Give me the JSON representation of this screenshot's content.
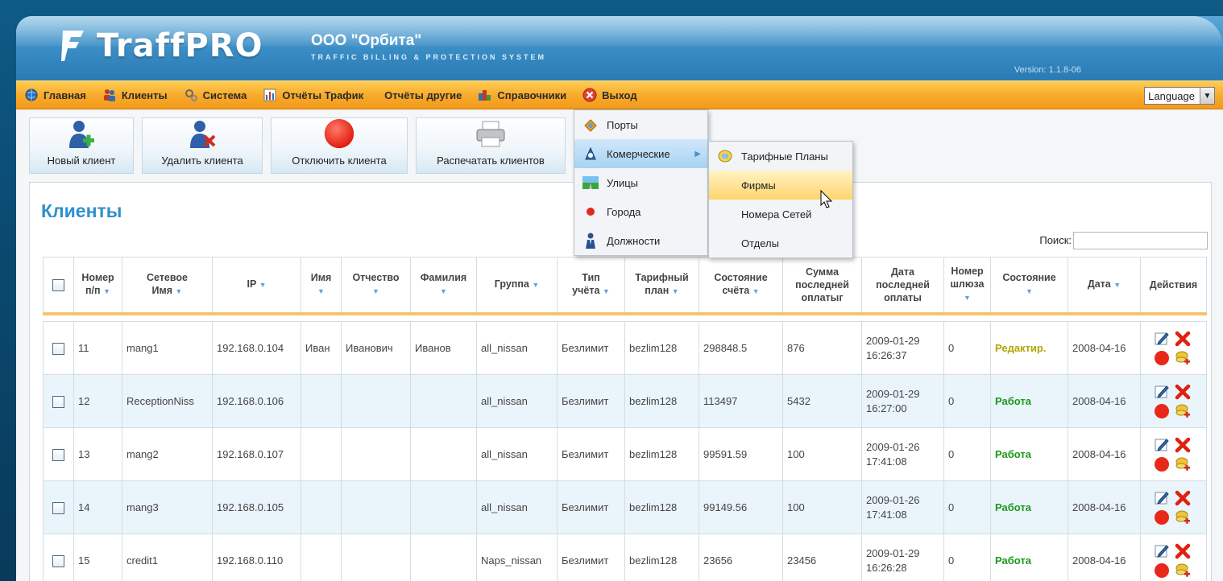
{
  "header": {
    "logo_text": "TraffPRO",
    "company": "ООО \"Орбита\"",
    "tagline": "TRAFFIC BILLING & PROTECTION SYSTEM",
    "version": "Version: 1.1.8-06"
  },
  "menu": {
    "items": [
      {
        "label": "Главная",
        "icon": "globe-icon"
      },
      {
        "label": "Клиенты",
        "icon": "users-icon"
      },
      {
        "label": "Система",
        "icon": "gears-icon"
      },
      {
        "label": "Отчёты Трафик",
        "icon": "bar-chart-icon"
      },
      {
        "label": "Отчёты другие",
        "icon": ""
      },
      {
        "label": "Справочники",
        "icon": "directory-icon"
      },
      {
        "label": "Выход",
        "icon": "exit-icon"
      }
    ],
    "language": "Language"
  },
  "toolbar": {
    "new_client": "Новый клиент",
    "delete_client": "Удалить клиента",
    "disable_client": "Отключить клиента",
    "print_clients": "Распечатать клиентов"
  },
  "dropdown": {
    "items": [
      "Порты",
      "Комерческие",
      "Улицы",
      "Города",
      "Должности"
    ],
    "submenu": [
      "Тарифные Планы",
      "Фирмы",
      "Номера Сетей",
      "Отделы"
    ]
  },
  "page": {
    "title": "Клиенты",
    "search_label": "Поиск:"
  },
  "table": {
    "headers": {
      "num": [
        "Номер",
        "п/п"
      ],
      "netname": [
        "Сетевое",
        "Имя"
      ],
      "ip": "IP",
      "name": "Имя",
      "patronymic": "Отчество",
      "surname": "Фамилия",
      "group": "Группа",
      "acct_type": [
        "Тип",
        "учёта"
      ],
      "tariff": [
        "Тарифный",
        "план"
      ],
      "balance": [
        "Состояние",
        "счёта"
      ],
      "last_payment": [
        "Сумма",
        "последней",
        "оплатыг"
      ],
      "last_payment_date": [
        "Дата",
        "последней",
        "оплаты"
      ],
      "gateway": [
        "Номер",
        "шлюза"
      ],
      "state": "Состояние",
      "date": "Дата",
      "actions": "Действия"
    },
    "rows": [
      {
        "num": "11",
        "netname": "mang1",
        "ip": "192.168.0.104",
        "name": "Иван",
        "patronymic": "Иванович",
        "surname": "Иванов",
        "group": "all_nissan",
        "acct_type": "Безлимит",
        "tariff": "bezlim128",
        "balance": "298848.5",
        "last_payment": "876",
        "pay_date": "2009-01-29",
        "pay_time": "16:26:37",
        "gateway": "0",
        "state": "Редактир.",
        "state_kind": "edit",
        "date": "2008-04-16"
      },
      {
        "num": "12",
        "netname": "ReceptionNiss",
        "ip": "192.168.0.106",
        "name": "",
        "patronymic": "",
        "surname": "",
        "group": "all_nissan",
        "acct_type": "Безлимит",
        "tariff": "bezlim128",
        "balance": "113497",
        "last_payment": "5432",
        "pay_date": "2009-01-29",
        "pay_time": "16:27:00",
        "gateway": "0",
        "state": "Работа",
        "state_kind": "work",
        "date": "2008-04-16"
      },
      {
        "num": "13",
        "netname": "mang2",
        "ip": "192.168.0.107",
        "name": "",
        "patronymic": "",
        "surname": "",
        "group": "all_nissan",
        "acct_type": "Безлимит",
        "tariff": "bezlim128",
        "balance": "99591.59",
        "last_payment": "100",
        "pay_date": "2009-01-26",
        "pay_time": "17:41:08",
        "gateway": "0",
        "state": "Работа",
        "state_kind": "work",
        "date": "2008-04-16"
      },
      {
        "num": "14",
        "netname": "mang3",
        "ip": "192.168.0.105",
        "name": "",
        "patronymic": "",
        "surname": "",
        "group": "all_nissan",
        "acct_type": "Безлимит",
        "tariff": "bezlim128",
        "balance": "99149.56",
        "last_payment": "100",
        "pay_date": "2009-01-26",
        "pay_time": "17:41:08",
        "gateway": "0",
        "state": "Работа",
        "state_kind": "work",
        "date": "2008-04-16"
      },
      {
        "num": "15",
        "netname": "credit1",
        "ip": "192.168.0.110",
        "name": "",
        "patronymic": "",
        "surname": "",
        "group": "Naps_nissan",
        "acct_type": "Безлимит",
        "tariff": "bezlim128",
        "balance": "23656",
        "last_payment": "23456",
        "pay_date": "2009-01-29",
        "pay_time": "16:26:28",
        "gateway": "0",
        "state": "Работа",
        "state_kind": "work",
        "date": "2008-04-16"
      }
    ]
  }
}
